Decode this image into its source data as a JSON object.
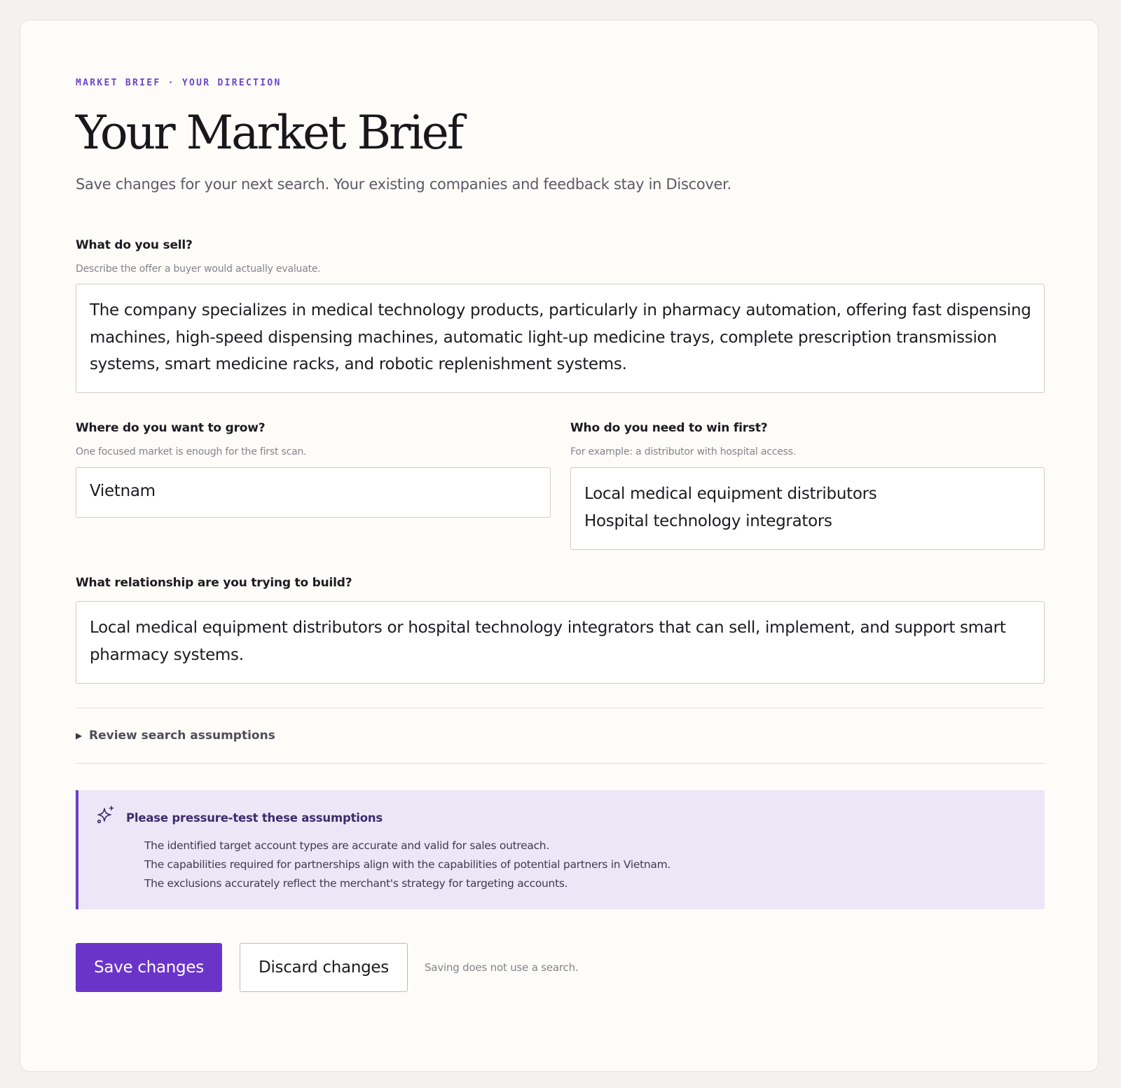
{
  "header": {
    "eyebrow": "MARKET BRIEF · YOUR DIRECTION",
    "title": "Your Market Brief",
    "subtitle": "Save changes for your next search. Your existing companies and feedback stay in Discover."
  },
  "sell": {
    "label": "What do you sell?",
    "hint": "Describe the offer a buyer would actually evaluate.",
    "lines": [
      "The company specializes in medical technology products, particularly in pharmacy automation, offering fast dispensing",
      "machines, high-speed dispensing machines, automatic light-up medicine trays, complete prescription transmission",
      "systems, smart medicine racks, and robotic replenishment systems."
    ]
  },
  "grow": {
    "label": "Where do you want to grow?",
    "hint": "One focused market is enough for the first scan.",
    "value": "Vietnam"
  },
  "win": {
    "label": "Who do you need to win first?",
    "hint": "For example: a distributor with hospital access.",
    "lines": [
      "Local medical equipment distributors",
      "Hospital technology integrators"
    ]
  },
  "relationship": {
    "label": "What relationship are you trying to build?",
    "lines": [
      "Local medical equipment distributors or hospital technology integrators that can sell, implement, and support smart",
      "pharmacy systems."
    ]
  },
  "assumptions_toggle": {
    "icon": "triangle-right-icon",
    "label": "Review search assumptions"
  },
  "callout": {
    "icon": "sparkle-icon",
    "title": "Please pressure-test these assumptions",
    "items": [
      "The identified target account types are accurate and valid for sales outreach.",
      "The capabilities required for partnerships align with the capabilities of potential partners in Vietnam.",
      "The exclusions accurately reflect the merchant's strategy for targeting accounts."
    ]
  },
  "actions": {
    "save_label": "Save changes",
    "discard_label": "Discard changes",
    "note": "Saving does not use a search."
  },
  "colors": {
    "accent": "#6b34c9",
    "eyebrow": "#6e47c9",
    "callout_bg": "#ece7f7",
    "page_bg": "#f4f2ee",
    "card_bg": "#fdfcf9"
  }
}
